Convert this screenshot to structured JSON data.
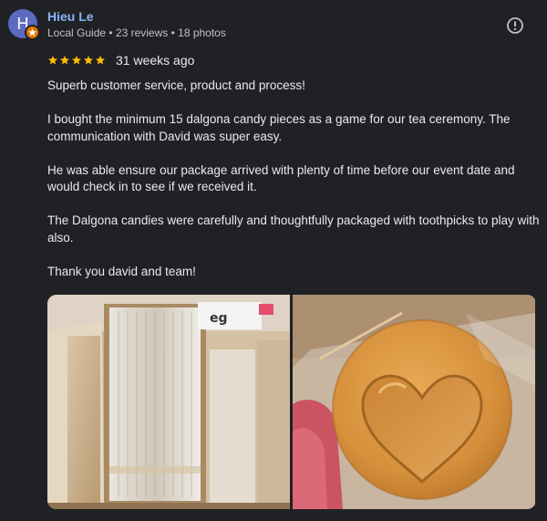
{
  "reviewer": {
    "initial": "H",
    "name": "Hieu Le",
    "meta": "Local Guide • 23 reviews • 18 photos",
    "avatar_color": "#5c6bc0",
    "badge_color": "#e37400"
  },
  "review": {
    "rating": 5,
    "rating_max": 5,
    "time_ago": "31 weeks ago",
    "paragraphs": [
      "Superb customer service, product and process!",
      "I bought the minimum 15 dalgona candy pieces as a game for our tea ceremony. The communication with David was super easy.",
      "He was able ensure our package arrived with plenty of time before our event date and would check in to see if we received it.",
      "The Dalgona candies were carefully and thoughtfully packaged with toothpicks to play with also.",
      "Thank you david and team!"
    ]
  },
  "photos": [
    {
      "icon": "photo-boxed-candies"
    },
    {
      "icon": "photo-heart-candy"
    }
  ],
  "colors": {
    "background": "#202124",
    "link": "#8ab4f8",
    "star": "#fbbc04",
    "text": "#e8eaed",
    "muted": "#bdc1c6"
  },
  "icons": {
    "more": "exclamation-circle-icon",
    "badge": "local-guide-star-icon",
    "star": "star-icon"
  }
}
